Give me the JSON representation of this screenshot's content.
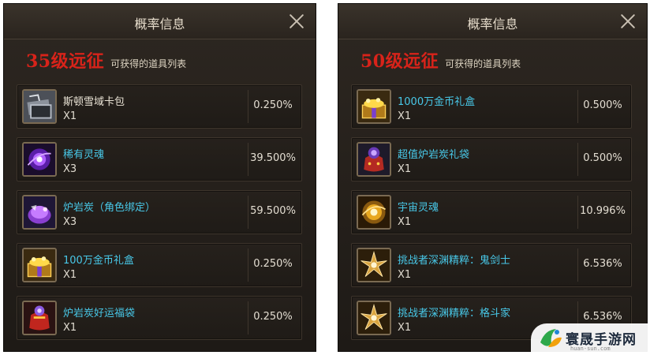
{
  "left_panel": {
    "title": "概率信息",
    "level": "35级远征",
    "caption": "可获得的道具列表",
    "items": [
      {
        "name": "斯顿雪域卡包",
        "qty": "X1",
        "pct": "0.250%",
        "icon": "card-pack-icon",
        "cyan": false
      },
      {
        "name": "稀有灵魂",
        "qty": "X3",
        "pct": "39.500%",
        "icon": "purple-soul-icon",
        "cyan": true
      },
      {
        "name": "炉岩炭（角色绑定）",
        "qty": "X3",
        "pct": "59.500%",
        "icon": "magma-coal-icon",
        "cyan": true
      },
      {
        "name": "100万金币礼盒",
        "qty": "X1",
        "pct": "0.250%",
        "icon": "gold-box-icon",
        "cyan": true
      },
      {
        "name": "炉岩炭好运福袋",
        "qty": "X1",
        "pct": "0.250%",
        "icon": "lucky-bag-icon",
        "cyan": true
      }
    ]
  },
  "right_panel": {
    "title": "概率信息",
    "level": "50级远征",
    "caption": "可获得的道具列表",
    "items": [
      {
        "name": "1000万金币礼盒",
        "qty": "X1",
        "pct": "0.500%",
        "icon": "gold-box-icon",
        "cyan": true
      },
      {
        "name": "超值炉岩炭礼袋",
        "qty": "X1",
        "pct": "0.500%",
        "icon": "coal-bag-icon",
        "cyan": true
      },
      {
        "name": "宇宙灵魂",
        "qty": "X1",
        "pct": "10.996%",
        "icon": "cosmic-soul-icon",
        "cyan": true
      },
      {
        "name": "挑战者深渊精粹：鬼剑士",
        "qty": "X1",
        "pct": "6.536%",
        "icon": "abyss-essence-icon",
        "cyan": true
      },
      {
        "name": "挑战者深渊精粹：格斗家",
        "qty": "X1",
        "pct": "6.536%",
        "icon": "abyss-essence-icon",
        "cyan": true
      }
    ]
  },
  "watermark": {
    "text": "寰晟手游网",
    "url": "huan-sun.com"
  },
  "colors": {
    "level": "#d8231a",
    "item_name": "#48c8e8",
    "panel_bg": "#1e1a16"
  }
}
